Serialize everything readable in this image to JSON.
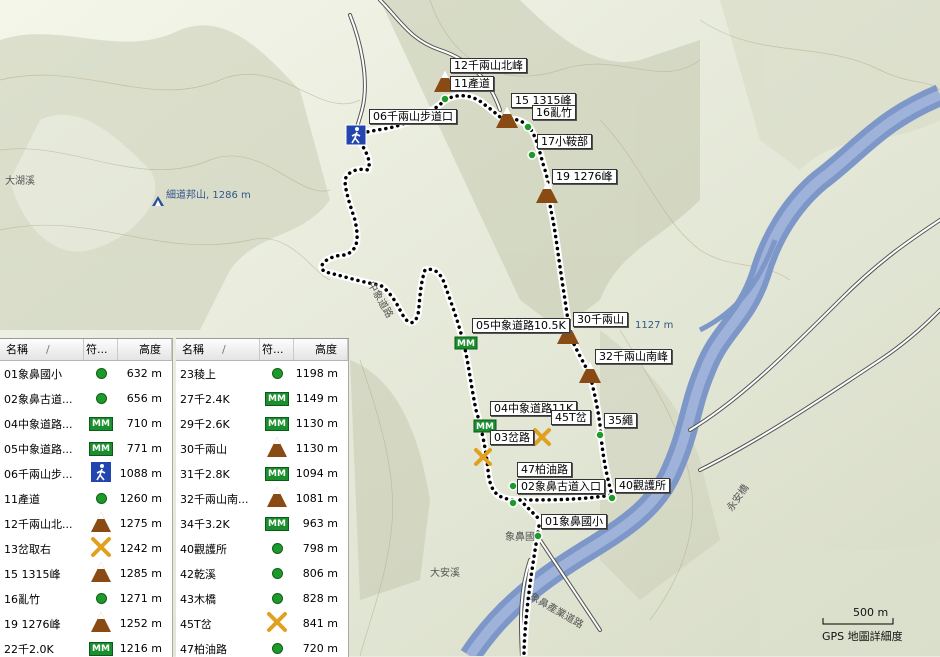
{
  "map": {
    "labels": {
      "big_mouth_creek": "大湖溪",
      "elephant_nose_school": "象鼻國",
      "da_an_creek": "大安溪",
      "yongan_bridge": "永安橋",
      "peak_xidaobang": "細道邦山, 1286 m",
      "peak_qianliang_elev": "1127 m",
      "road_label": "中象道路",
      "road_lower": "象鼻產業道路",
      "scale_text": "500 m",
      "detail_text": "GPS 地圖詳細度"
    },
    "waypoint_labels": [
      {
        "key": "w12",
        "text": "12千兩山北峰"
      },
      {
        "key": "w11",
        "text": "11產道"
      },
      {
        "key": "w15",
        "text": "15 1315峰"
      },
      {
        "key": "w16",
        "text": "16亂竹"
      },
      {
        "key": "w06",
        "text": "06千兩山步道口"
      },
      {
        "key": "w17",
        "text": "17小鞍部"
      },
      {
        "key": "w19",
        "text": "19 1276峰"
      },
      {
        "key": "w30",
        "text": "30千兩山"
      },
      {
        "key": "w05",
        "text": "05中象道路10.5K"
      },
      {
        "key": "w32",
        "text": "32千兩山南峰"
      },
      {
        "key": "w04",
        "text": "04中象道路11K"
      },
      {
        "key": "w45",
        "text": "45T岔"
      },
      {
        "key": "w35",
        "text": "35繩"
      },
      {
        "key": "w03",
        "text": "03岔路"
      },
      {
        "key": "w47",
        "text": "47柏油路"
      },
      {
        "key": "w02",
        "text": "02象鼻古道入口"
      },
      {
        "key": "w40",
        "text": "40觀護所"
      },
      {
        "key": "w01",
        "text": "01象鼻國小"
      }
    ],
    "colors": {
      "river": "#7d97c9",
      "track": "#000000",
      "road": "#ffffff",
      "waypoint": "#1c9a2a"
    }
  },
  "table": {
    "headers": {
      "name": "名稱",
      "sym": "符...",
      "alt": "高度"
    },
    "left_rows": [
      {
        "name": "01象鼻國小",
        "icon": "dot",
        "alt": "632 m"
      },
      {
        "name": "02象鼻古道...",
        "icon": "dot",
        "alt": "656 m"
      },
      {
        "name": "04中象道路...",
        "icon": "mm",
        "alt": "710 m"
      },
      {
        "name": "05中象道路...",
        "icon": "mm",
        "alt": "771 m"
      },
      {
        "name": "06千兩山步...",
        "icon": "hiker",
        "alt": "1088 m"
      },
      {
        "name": "11產道",
        "icon": "dot",
        "alt": "1260 m"
      },
      {
        "name": "12千兩山北...",
        "icon": "peak",
        "alt": "1275 m"
      },
      {
        "name": "13岔取右",
        "icon": "cross",
        "alt": "1242 m"
      },
      {
        "name": "15 1315峰",
        "icon": "peak",
        "alt": "1285 m"
      },
      {
        "name": "16亂竹",
        "icon": "dot",
        "alt": "1271 m"
      },
      {
        "name": "19 1276峰",
        "icon": "peak",
        "alt": "1252 m"
      },
      {
        "name": "22千2.0K",
        "icon": "mm",
        "alt": "1216 m"
      }
    ],
    "right_rows": [
      {
        "name": "23稜上",
        "icon": "dot",
        "alt": "1198 m"
      },
      {
        "name": "27千2.4K",
        "icon": "mm",
        "alt": "1149 m"
      },
      {
        "name": "29千2.6K",
        "icon": "mm",
        "alt": "1130 m"
      },
      {
        "name": "30千兩山",
        "icon": "peak",
        "alt": "1130 m"
      },
      {
        "name": "31千2.8K",
        "icon": "mm",
        "alt": "1094 m"
      },
      {
        "name": "32千兩山南...",
        "icon": "peak",
        "alt": "1081 m"
      },
      {
        "name": "34千3.2K",
        "icon": "mm",
        "alt": "963 m"
      },
      {
        "name": "40觀護所",
        "icon": "dot",
        "alt": "798 m"
      },
      {
        "name": "42乾溪",
        "icon": "dot",
        "alt": "806 m"
      },
      {
        "name": "43木橋",
        "icon": "dot",
        "alt": "828 m"
      },
      {
        "name": "45T岔",
        "icon": "cross",
        "alt": "841 m"
      },
      {
        "name": "47柏油路",
        "icon": "dot",
        "alt": "720 m"
      }
    ],
    "mm_text": "MM"
  }
}
